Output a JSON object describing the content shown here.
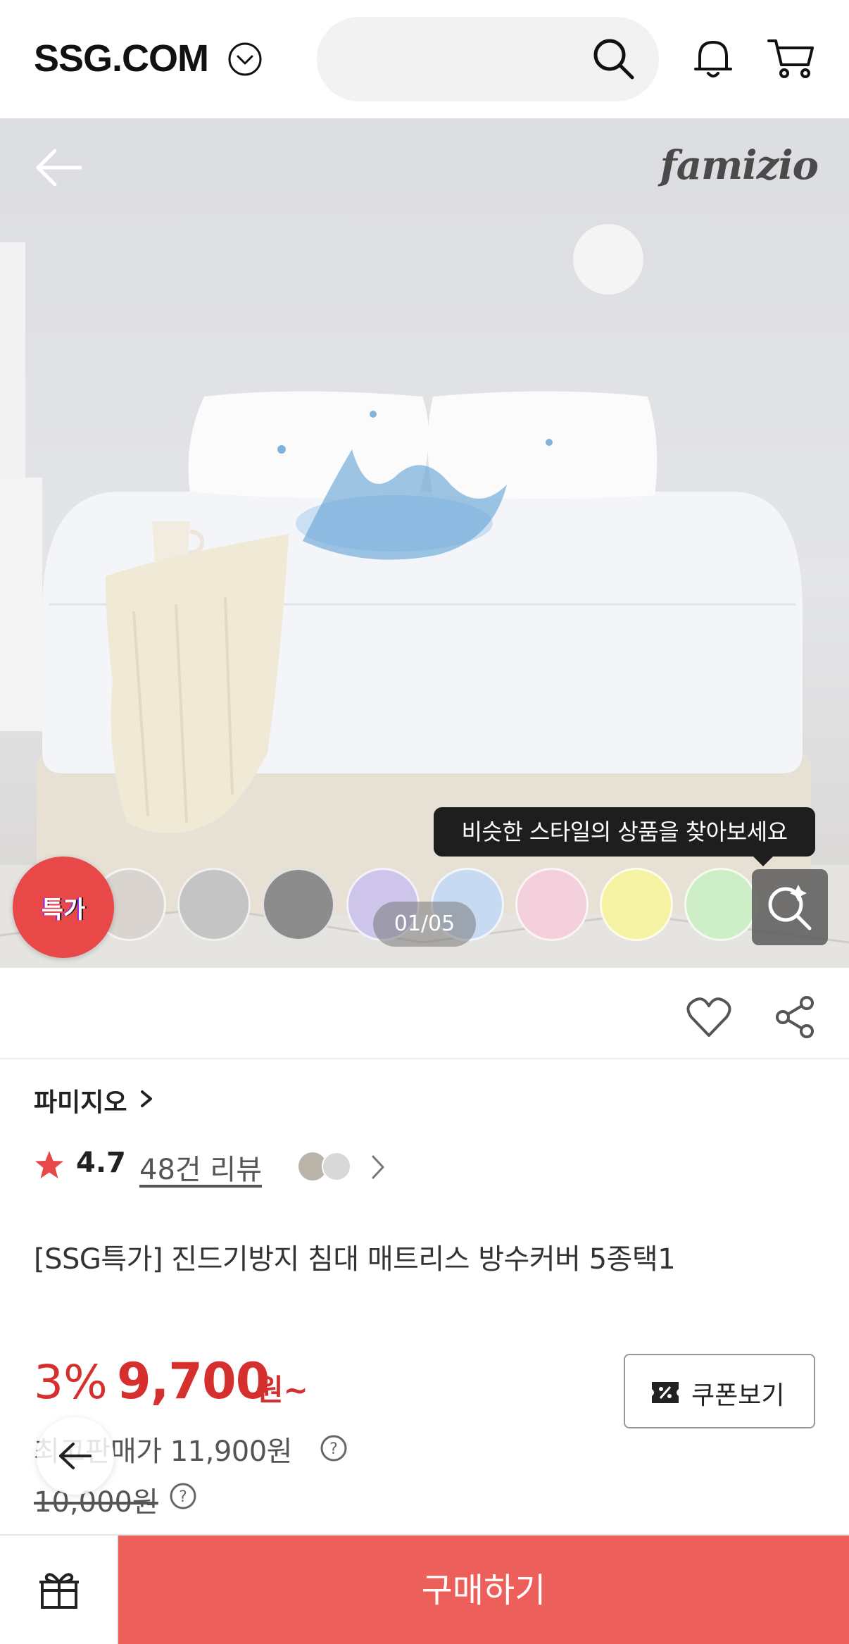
{
  "header": {
    "logo": "SSG.COM",
    "icons": [
      "chevron-down-circle-icon",
      "search-icon",
      "bell-icon",
      "cart-icon"
    ]
  },
  "hero": {
    "brand_watermark": "famizio",
    "tooltip": "비슷한 스타일의 상품을 찾아보세요",
    "page_indicator": "01/05",
    "badge_label": "특가",
    "swatch_colors": [
      "#d9d4cf",
      "#c4c4c4",
      "#8c8c8c",
      "#cdc6ea",
      "#c8daf2",
      "#f4cfdc",
      "#f6f2a4",
      "#cdeec6"
    ]
  },
  "product": {
    "brand": "파미지오",
    "rating": "4.7",
    "review_count": "48건 리뷰",
    "title": "[SSG특가] 진드기방지 침대 매트리스 방수커버 5종택1",
    "discount_rate": "3%",
    "price": "9,700",
    "price_unit": "원~",
    "coupon_label": "쿠폰보기",
    "best_price": "최고판매가 11,900원",
    "original_price": "10,000원"
  },
  "bottom_bar": {
    "buy_label": "구매하기"
  },
  "colors": {
    "accent_red": "#d6302e",
    "buy_button": "#ec5f5a",
    "star": "#e84848"
  }
}
